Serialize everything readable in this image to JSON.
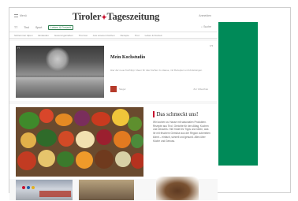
{
  "header": {
    "menu_label": "Menü",
    "logo_left": "Tiroler",
    "logo_right": "Tageszeitung",
    "right_label": "Anmelden",
    "subnav": [
      "TT",
      "Tirol",
      "Sport",
      "Leben & Freizeit"
    ],
    "search_label": "Suche"
  },
  "sections": [
    "Schlemmer Alpen",
    "Einkaufen",
    "Gesund genießen",
    "Tirol isst",
    "Aus unseren Küchen",
    "Rezepte",
    "Tirol",
    "Leben & Freizeit"
  ],
  "top_article": {
    "image_caption": "TT",
    "tag": "1/3",
    "title": "Mein Kochstudio",
    "description": "Hier der neue Kochtipp: Ideen für das Kochen zu Hause, mit Rezepten und Anleitungen.",
    "source": "Sieger",
    "more": "Zur Videothek"
  },
  "feature": {
    "title": "Das schmeckt uns!",
    "text": "Wir kochen zu Hause mit saisonalen Produkten. Rezepte aus Tirol, Gerichte für den Alltag, Kuchen und Desserts. Hier findet ihr Tipps und Ideen, was ihr mit frischem Gemüse aus der Region zubereiten könnt – einfach, schnell und gesund. Alles über Küche und Genuss."
  },
  "colors": {
    "brand_red": "#c8102e",
    "ad_green": "#008a58"
  }
}
